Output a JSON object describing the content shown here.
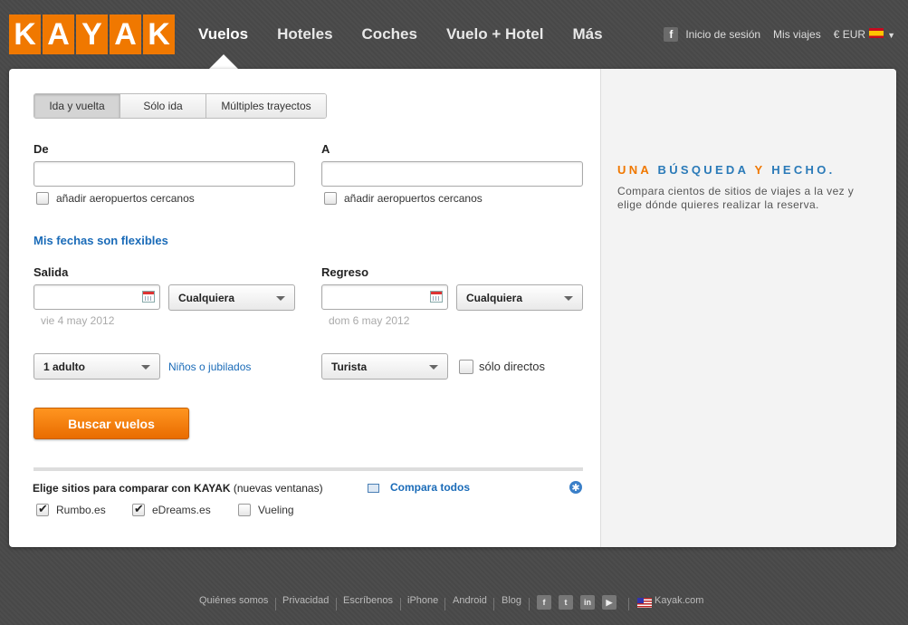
{
  "logo": {
    "letters": [
      "K",
      "A",
      "Y",
      "A",
      "K"
    ]
  },
  "nav": {
    "items": [
      "Vuelos",
      "Hoteles",
      "Coches",
      "Vuelo + Hotel",
      "Más"
    ]
  },
  "header_right": {
    "facebook_letter": "f",
    "login": "Inicio de sesión",
    "trips": "Mis viajes",
    "currency": "€ EUR"
  },
  "trip_tabs": [
    "Ida y vuelta",
    "Sólo ida",
    "Múltiples trayectos"
  ],
  "from": {
    "label": "De",
    "value": "",
    "nearby": "añadir aeropuertos cercanos"
  },
  "to": {
    "label": "A",
    "value": "",
    "nearby": "añadir aeropuertos cercanos"
  },
  "flexible_link": "Mis fechas son flexibles",
  "depart": {
    "label": "Salida",
    "value": "",
    "time": "Cualquiera",
    "hint": "vie 4 may 2012"
  },
  "return": {
    "label": "Regreso",
    "value": "",
    "time": "Cualquiera",
    "hint": "dom 6 may 2012"
  },
  "passengers": {
    "value": "1 adulto",
    "children_link": "Niños o jubilados"
  },
  "cabin": {
    "value": "Turista",
    "direct_label": "sólo directos"
  },
  "search_button": "Buscar vuelos",
  "compare": {
    "prefix": "Elige sitios para comparar con KAYAK",
    "suffix": " (nuevas ventanas)",
    "compare_all": "Compara todos",
    "sites": [
      {
        "name": "Rumbo.es",
        "checked": true
      },
      {
        "name": "eDreams.es",
        "checked": true
      },
      {
        "name": "Vueling",
        "checked": false
      }
    ]
  },
  "promo": {
    "tagline": [
      {
        "t": "UNA",
        "c": "o"
      },
      {
        "t": "BÚSQUEDA",
        "c": "b"
      },
      {
        "t": "Y",
        "c": "o"
      },
      {
        "t": "HECHO.",
        "c": "b"
      }
    ],
    "text": "Compara cientos de sitios de viajes a la vez y elige dónde quieres realizar la reserva."
  },
  "footer": {
    "links": [
      "Quiénes somos",
      "Privacidad",
      "Escríbenos",
      "iPhone",
      "Android",
      "Blog"
    ],
    "site": "Kayak.com"
  }
}
